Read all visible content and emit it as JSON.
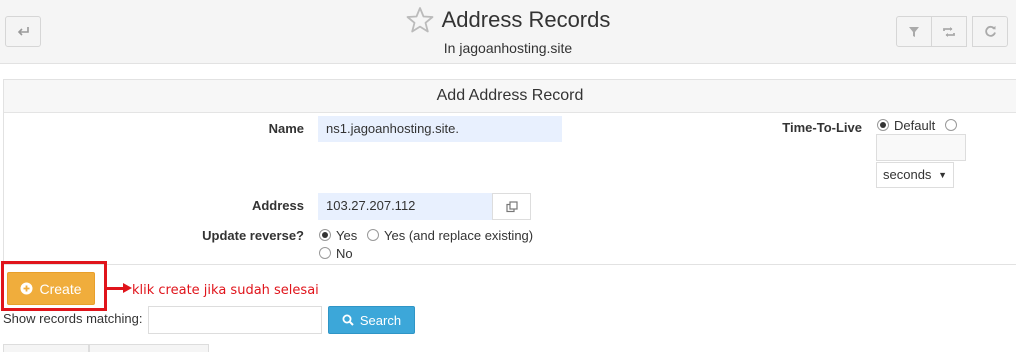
{
  "header": {
    "title": "Address Records",
    "subtitle": "In jagoanhosting.site"
  },
  "icons": {
    "back": "back-arrow-icon",
    "star": "star-icon",
    "filter": "filter-icon",
    "sync": "sync-icon",
    "refresh": "refresh-icon"
  },
  "form": {
    "heading": "Add Address Record",
    "name_label": "Name",
    "name_value": "ns1.jagoanhosting.site.",
    "ttl_label": "Time-To-Live",
    "ttl_default_label": "Default",
    "ttl_unit": "seconds",
    "address_label": "Address",
    "address_value": "103.27.207.112",
    "update_reverse_label": "Update reverse?",
    "reverse_options": [
      "Yes",
      "Yes (and replace existing)",
      "No"
    ]
  },
  "actions": {
    "create_label": "Create",
    "annotation": "klik create jika sudah selesai"
  },
  "search": {
    "label": "Show records matching:",
    "button_label": "Search"
  },
  "colors": {
    "create_button": "#f0ad3c",
    "search_button": "#3ca7d9",
    "annotation": "#e0141b",
    "autofill_field": "#e8f0fe"
  }
}
